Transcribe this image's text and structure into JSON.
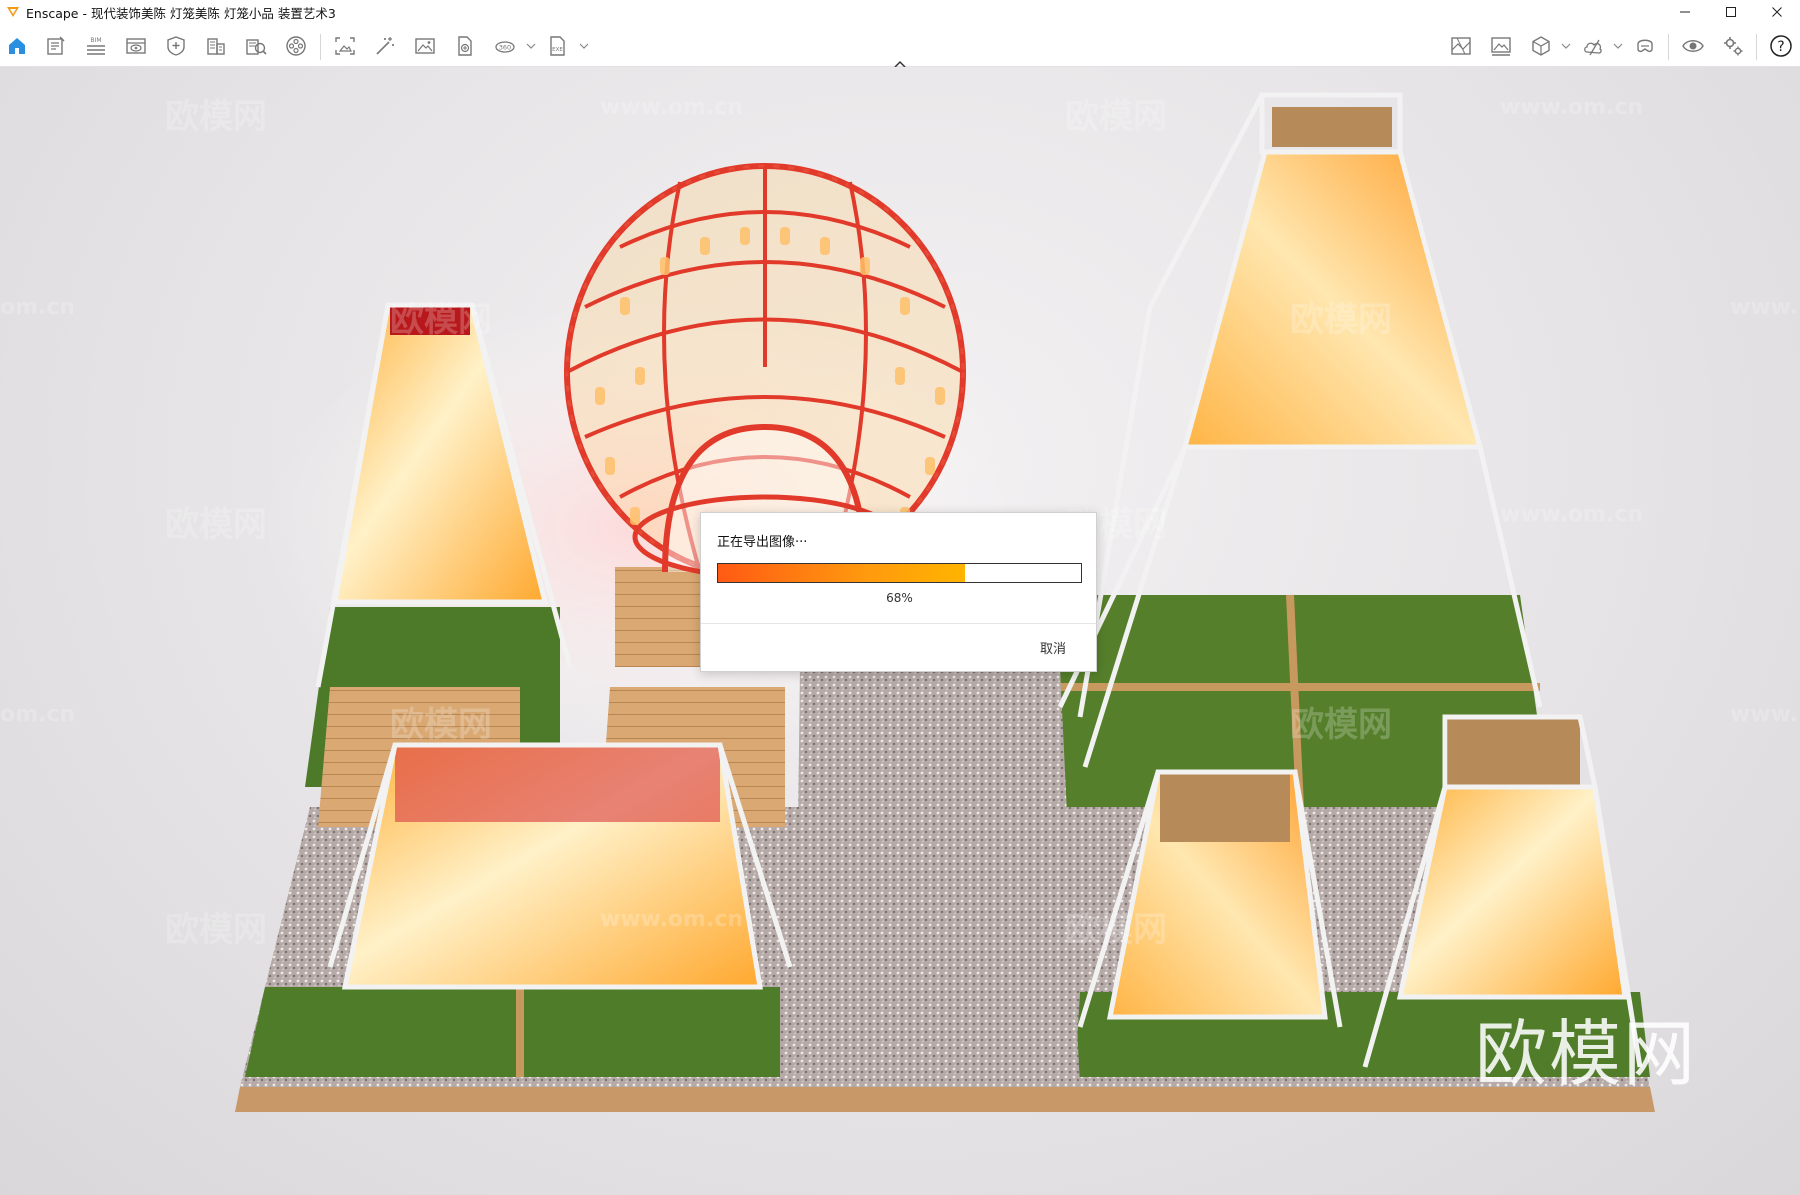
{
  "window": {
    "title": "Enscape - 现代装饰美陈 灯笼美陈 灯笼小品 装置艺术3",
    "minimize_icon": "minimize-icon",
    "maximize_icon": "maximize-icon",
    "close_icon": "close-icon"
  },
  "toolbar": {
    "left_icons": [
      "home-icon",
      "document-icon",
      "bim-icon",
      "view-icon",
      "safe-frame-icon",
      "building-icon",
      "asset-library-icon",
      "video-icon"
    ],
    "middle_icons": [
      "screenshot-icon",
      "batch-render-icon",
      "image-icon",
      "export-file-icon",
      "panorama-360-icon",
      "exe-export-icon"
    ],
    "right_icons": [
      "map-view-icon",
      "panorama-gallery-icon",
      "cube-icon",
      "cloud-upload-icon",
      "vr-headset-icon",
      "eye-icon",
      "settings-icon",
      "help-icon"
    ],
    "bim_label": "BIM",
    "panorama_label": "360",
    "exe_label": "EXE",
    "help_label": "?"
  },
  "watermarks": {
    "logo_text": "欧模网",
    "url_text": "www.om.cn",
    "url_short": "om.cn",
    "url_prefix": "www."
  },
  "dialog": {
    "title": "正在导出图像···",
    "progress": 0.68,
    "progress_text": "68%",
    "cancel_label": "取消"
  },
  "colors": {
    "accent": "#ff8a00",
    "progress_start": "#ff5a14",
    "progress_end": "#ffb400",
    "enscape_logo": "#f29a1a"
  }
}
